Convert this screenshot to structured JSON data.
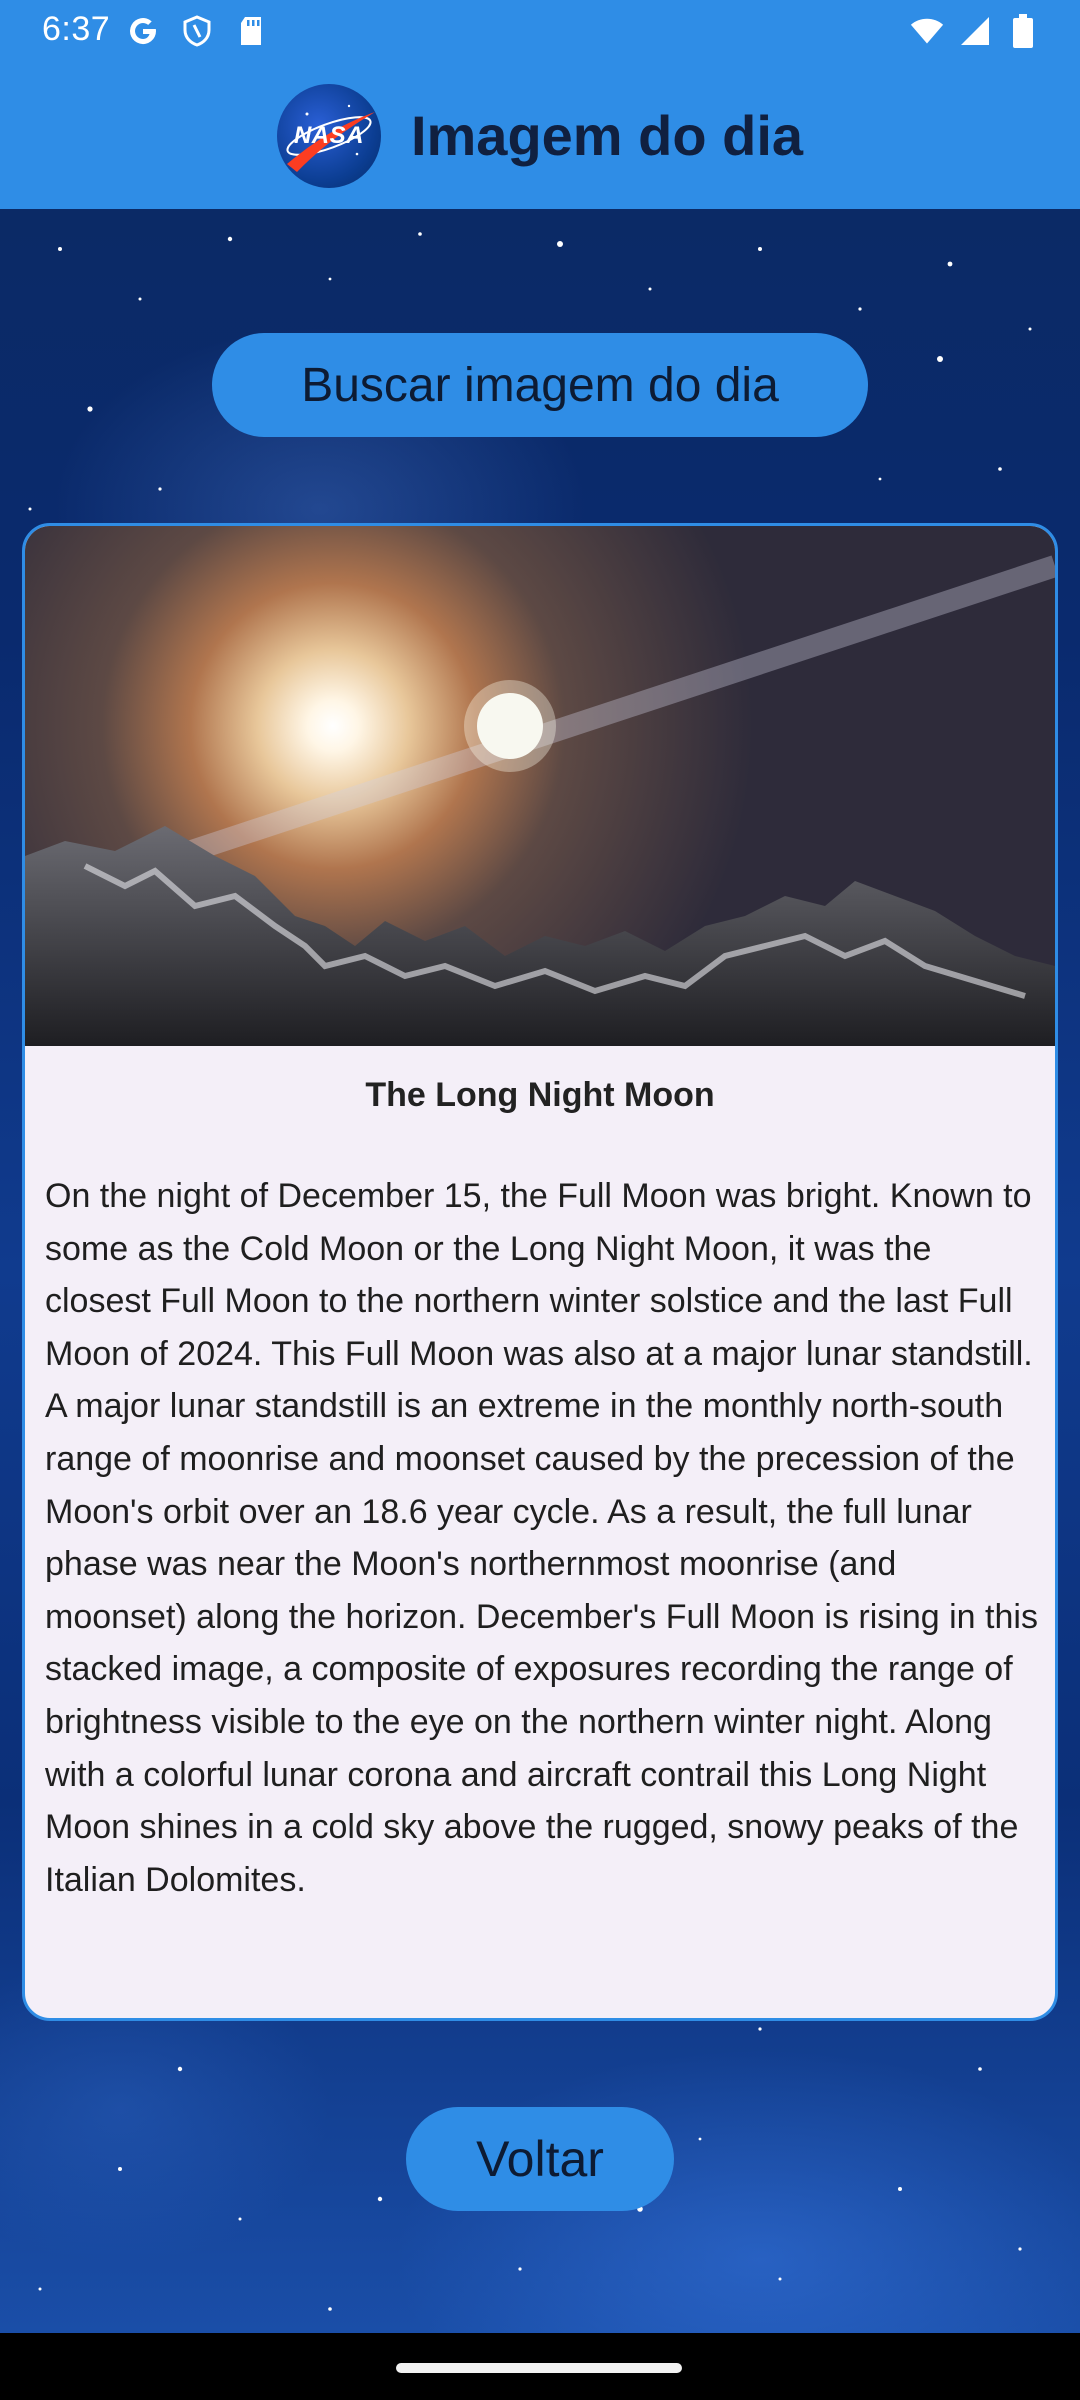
{
  "status_bar": {
    "time": "6:37",
    "left_icons": [
      "google-icon",
      "shield-icon",
      "sd-card-icon"
    ],
    "right_icons": [
      "wifi-icon",
      "signal-icon",
      "battery-icon"
    ]
  },
  "app_bar": {
    "logo_text": "NASA",
    "title": "Imagem do dia"
  },
  "actions": {
    "fetch_label": "Buscar imagem do dia",
    "back_label": "Voltar"
  },
  "apod": {
    "title": "The Long Night Moon",
    "explanation": "On the night of December 15, the Full Moon was bright. Known to some as the Cold Moon or the Long Night Moon, it was the closest Full Moon to the northern winter solstice and the last Full Moon of 2024. This Full Moon was also at a major lunar standstill. A major lunar standstill is an extreme in the monthly north-south range of moonrise and moonset caused by the precession of the Moon's orbit over an 18.6 year cycle. As a result, the full lunar phase was near the Moon's northernmost moonrise (and moonset) along the horizon.  December's Full Moon is rising in this stacked image, a composite of exposures recording the range of brightness visible to the eye on the northern winter night. Along with a colorful lunar corona and aircraft contrail this Long Night Moon shines in a cold sky above the rugged, snowy peaks of the Italian Dolomites."
  },
  "colors": {
    "primary": "#2f8de6",
    "card_bg": "#f4eff8",
    "title_text": "#102040"
  }
}
